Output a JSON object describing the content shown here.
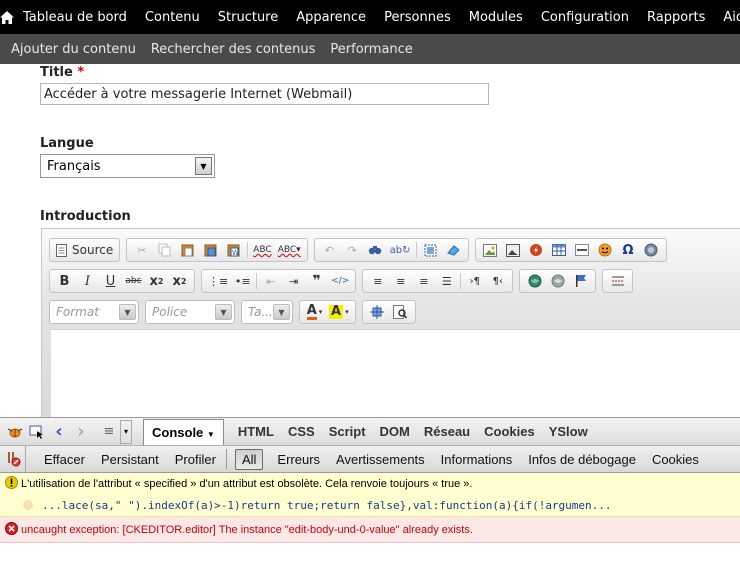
{
  "admin_menu": {
    "home_icon": "home-icon",
    "items": [
      "Tableau de bord",
      "Contenu",
      "Structure",
      "Apparence",
      "Personnes",
      "Modules",
      "Configuration",
      "Rapports",
      "Aide"
    ]
  },
  "shortcuts": {
    "items": [
      "Ajouter du contenu",
      "Rechercher des contenus",
      "Performance"
    ]
  },
  "form": {
    "title_label": "Title",
    "required_mark": "*",
    "title_value": "Accéder à votre messagerie Internet (Webmail)",
    "language_label": "Langue",
    "language_value": "Français",
    "intro_label": "Introduction"
  },
  "editor": {
    "source_label": "Source",
    "format_placeholder": "Format",
    "font_placeholder": "Police",
    "size_placeholder": "Ta..."
  },
  "firebug": {
    "panels": [
      "Console",
      "HTML",
      "CSS",
      "Script",
      "DOM",
      "Réseau",
      "Cookies",
      "YSlow"
    ],
    "active_panel": "Console",
    "console_buttons": [
      "Effacer",
      "Persistant",
      "Profiler"
    ],
    "filters": [
      "All",
      "Erreurs",
      "Avertissements",
      "Informations",
      "Infos de débogage",
      "Cookies"
    ],
    "active_filter": "All",
    "warning_text": "L'utilisation de l'attribut « specified » d'un attribut est obsolète. Cela renvoie toujours « true ».",
    "warning_code": "...lace(sa,\" \").indexOf(a)>-1)return true;return false},val:function(a){if(!argumen...",
    "error_text": "uncaught exception: [CKEDITOR.editor] The instance \"edit-body-und-0-value\" already exists."
  },
  "colors": {
    "topnav_bg": "#000000",
    "subnav_bg": "#4a4a4a",
    "warning_bg": "#ffffd0",
    "error_bg": "#fde8e8",
    "error_text": "#cc0000"
  }
}
